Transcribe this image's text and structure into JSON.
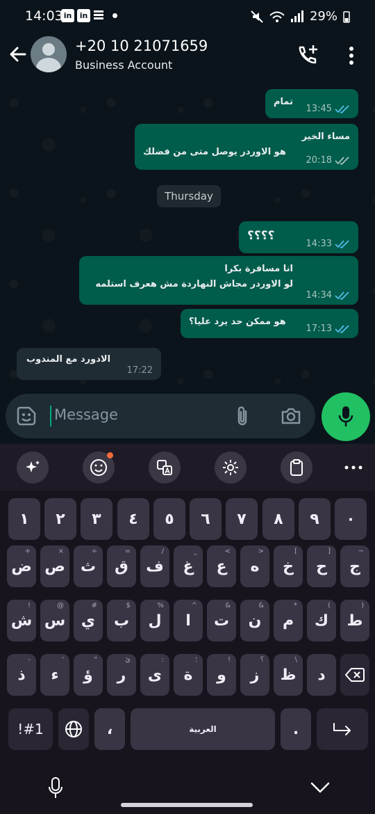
{
  "status_bar": {
    "time": "14:03",
    "apps": [
      "in",
      "in"
    ],
    "battery": "29%"
  },
  "header": {
    "contact_name": "+20 10 21071659",
    "subtitle": "Business Account",
    "icons": [
      "back-arrow-icon",
      "avatar",
      "add-call-icon",
      "more-vert-icon"
    ]
  },
  "messages": [
    {
      "dir": "out",
      "lines": [
        "تمام"
      ],
      "time": "13:45",
      "status": "read"
    },
    {
      "dir": "out",
      "lines": [
        "مساء الخير",
        "هو الاوردر يوصل متى من فضلك"
      ],
      "time": "20:18",
      "status": "delivered"
    },
    {
      "dir": "out",
      "lines": [
        "؟؟؟؟"
      ],
      "time": "14:33",
      "status": "read"
    },
    {
      "dir": "out",
      "lines": [
        "انا مسافرة بكرا",
        "لو الاوردر مجاش النهاردة مش هعرف استلمه"
      ],
      "time": "14:34",
      "status": "read"
    },
    {
      "dir": "out",
      "lines": [
        "هو ممكن حد يرد عليا؟"
      ],
      "time": "17:13",
      "status": "read"
    },
    {
      "dir": "in",
      "lines": [
        "الادورد مع المندوب"
      ],
      "time": "17:22"
    }
  ],
  "day_separator": "Thursday",
  "composer": {
    "placeholder": "Message"
  },
  "colors": {
    "background": "#0b141a",
    "outgoing_bubble": "#005c4b",
    "incoming_bubble": "#202c33",
    "accent_green": "#21c063",
    "read_ticks": "#53bdeb"
  },
  "keyboard": {
    "toolbar_icons": [
      "sparkle-icon",
      "emoji-icon",
      "translate-icon",
      "settings-icon",
      "clipboard-icon",
      "more-horiz-icon"
    ],
    "rows": [
      [
        {
          "k": "١"
        },
        {
          "k": "٢"
        },
        {
          "k": "٣"
        },
        {
          "k": "٤"
        },
        {
          "k": "٥"
        },
        {
          "k": "٦"
        },
        {
          "k": "٧"
        },
        {
          "k": "٨"
        },
        {
          "k": "٩"
        },
        {
          "k": "٠"
        }
      ],
      [
        {
          "k": "ض",
          "h": "+"
        },
        {
          "k": "ص",
          "h": "×"
        },
        {
          "k": "ث",
          "h": "÷"
        },
        {
          "k": "ق",
          "h": "="
        },
        {
          "k": "ف",
          "h": "/"
        },
        {
          "k": "غ",
          "h": "_"
        },
        {
          "k": "ع",
          "h": "<"
        },
        {
          "k": "ه",
          "h": ">"
        },
        {
          "k": "خ",
          "h": "["
        },
        {
          "k": "ح",
          "h": "]"
        },
        {
          "k": "ج",
          "h": "~"
        }
      ],
      [
        {
          "k": "ش",
          "h": "!"
        },
        {
          "k": "س",
          "h": "@"
        },
        {
          "k": "ي",
          "h": "#"
        },
        {
          "k": "ب",
          "h": "$"
        },
        {
          "k": "ل",
          "h": "%"
        },
        {
          "k": "ا",
          "h": "^"
        },
        {
          "k": "ت",
          "h": "&"
        },
        {
          "k": "ن",
          "h": "&"
        },
        {
          "k": "م",
          "h": "*"
        },
        {
          "k": "ك",
          "h": "("
        },
        {
          "k": "ط",
          "h": ")"
        }
      ],
      [
        {
          "k": "ذ",
          "h": "-"
        },
        {
          "k": "ء",
          "h": "'"
        },
        {
          "k": "ؤ",
          "h": "\""
        },
        {
          "k": "ر",
          "h": "ئ"
        },
        {
          "k": "ى",
          "h": ":"
        },
        {
          "k": "ة",
          "h": "؛"
        },
        {
          "k": "و",
          "h": "!"
        },
        {
          "k": "ز",
          "h": "؟"
        },
        {
          "k": "ظ",
          "h": "\\"
        },
        {
          "k": "د",
          "h": ""
        }
      ]
    ],
    "symbols_key": "!#1",
    "comma_key": "،",
    "space_label": "العربية",
    "period_key": "."
  }
}
